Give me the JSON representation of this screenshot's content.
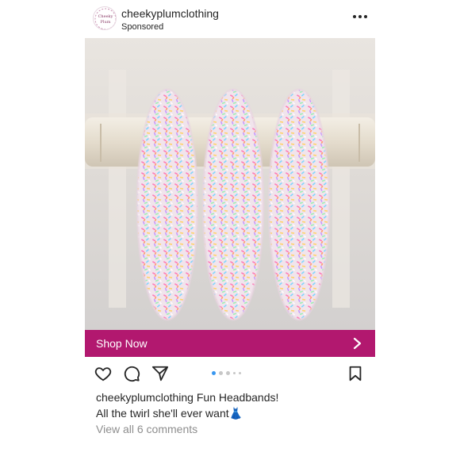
{
  "post": {
    "username": "cheekyplumclothing",
    "sponsored_label": "Sponsored",
    "avatar_logo_text": "Cheeky Plum",
    "more_icon": "more-horizontal-icon",
    "cta_label": "Shop Now",
    "cta_color": "#b2186f",
    "caption_username": "cheekyplumclothing",
    "caption_line1": "Fun Headbands!",
    "caption_line2": "All the twirl she'll ever want",
    "caption_emoji": "👗",
    "comments_link": "View all 6 comments",
    "carousel": {
      "count": 5,
      "active_index": 0
    },
    "actions": [
      "heart-icon",
      "comment-icon",
      "share-icon",
      "bookmark-icon"
    ]
  }
}
